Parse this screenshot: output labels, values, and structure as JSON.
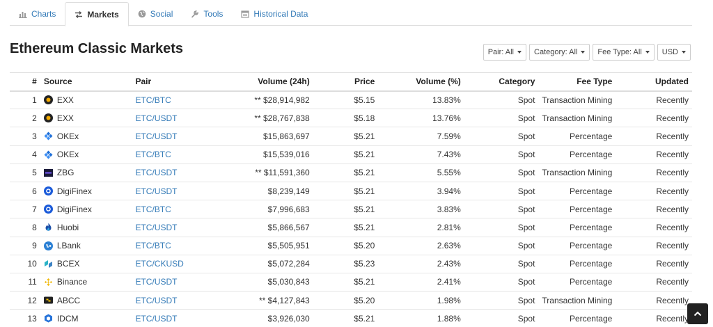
{
  "tabs": [
    {
      "label": "Charts",
      "icon": "bar-chart-icon",
      "active": false
    },
    {
      "label": "Markets",
      "icon": "exchange-arrows-icon",
      "active": true
    },
    {
      "label": "Social",
      "icon": "globe-icon",
      "active": false
    },
    {
      "label": "Tools",
      "icon": "wrench-icon",
      "active": false
    },
    {
      "label": "Historical Data",
      "icon": "calendar-icon",
      "active": false
    }
  ],
  "page_title": "Ethereum Classic Markets",
  "filters": {
    "pair": "Pair: All",
    "category": "Category: All",
    "fee_type": "Fee Type: All",
    "currency": "USD"
  },
  "table": {
    "headers": {
      "rank": "#",
      "source": "Source",
      "pair": "Pair",
      "volume": "Volume (24h)",
      "price": "Price",
      "volume_pct": "Volume (%)",
      "category": "Category",
      "fee_type": "Fee Type",
      "updated": "Updated"
    },
    "rows": [
      {
        "rank": "1",
        "source": "EXX",
        "logo": "exx",
        "pair": "ETC/BTC",
        "volume": "** $28,914,982",
        "price": "$5.15",
        "volume_pct": "13.83%",
        "category": "Spot",
        "fee_type": "Transaction Mining",
        "updated": "Recently"
      },
      {
        "rank": "2",
        "source": "EXX",
        "logo": "exx",
        "pair": "ETC/USDT",
        "volume": "** $28,767,838",
        "price": "$5.18",
        "volume_pct": "13.76%",
        "category": "Spot",
        "fee_type": "Transaction Mining",
        "updated": "Recently"
      },
      {
        "rank": "3",
        "source": "OKEx",
        "logo": "okex",
        "pair": "ETC/USDT",
        "volume": "$15,863,697",
        "price": "$5.21",
        "volume_pct": "7.59%",
        "category": "Spot",
        "fee_type": "Percentage",
        "updated": "Recently"
      },
      {
        "rank": "4",
        "source": "OKEx",
        "logo": "okex",
        "pair": "ETC/BTC",
        "volume": "$15,539,016",
        "price": "$5.21",
        "volume_pct": "7.43%",
        "category": "Spot",
        "fee_type": "Percentage",
        "updated": "Recently"
      },
      {
        "rank": "5",
        "source": "ZBG",
        "logo": "zbg",
        "pair": "ETC/USDT",
        "volume": "** $11,591,360",
        "price": "$5.21",
        "volume_pct": "5.55%",
        "category": "Spot",
        "fee_type": "Transaction Mining",
        "updated": "Recently"
      },
      {
        "rank": "6",
        "source": "DigiFinex",
        "logo": "digifinex",
        "pair": "ETC/USDT",
        "volume": "$8,239,149",
        "price": "$5.21",
        "volume_pct": "3.94%",
        "category": "Spot",
        "fee_type": "Percentage",
        "updated": "Recently"
      },
      {
        "rank": "7",
        "source": "DigiFinex",
        "logo": "digifinex",
        "pair": "ETC/BTC",
        "volume": "$7,996,683",
        "price": "$5.21",
        "volume_pct": "3.83%",
        "category": "Spot",
        "fee_type": "Percentage",
        "updated": "Recently"
      },
      {
        "rank": "8",
        "source": "Huobi",
        "logo": "huobi",
        "pair": "ETC/USDT",
        "volume": "$5,866,567",
        "price": "$5.21",
        "volume_pct": "2.81%",
        "category": "Spot",
        "fee_type": "Percentage",
        "updated": "Recently"
      },
      {
        "rank": "9",
        "source": "LBank",
        "logo": "lbank",
        "pair": "ETC/BTC",
        "volume": "$5,505,951",
        "price": "$5.20",
        "volume_pct": "2.63%",
        "category": "Spot",
        "fee_type": "Percentage",
        "updated": "Recently"
      },
      {
        "rank": "10",
        "source": "BCEX",
        "logo": "bcex",
        "pair": "ETC/CKUSD",
        "volume": "$5,072,284",
        "price": "$5.23",
        "volume_pct": "2.43%",
        "category": "Spot",
        "fee_type": "Percentage",
        "updated": "Recently"
      },
      {
        "rank": "11",
        "source": "Binance",
        "logo": "binance",
        "pair": "ETC/USDT",
        "volume": "$5,030,843",
        "price": "$5.21",
        "volume_pct": "2.41%",
        "category": "Spot",
        "fee_type": "Percentage",
        "updated": "Recently"
      },
      {
        "rank": "12",
        "source": "ABCC",
        "logo": "abcc",
        "pair": "ETC/USDT",
        "volume": "** $4,127,843",
        "price": "$5.20",
        "volume_pct": "1.98%",
        "category": "Spot",
        "fee_type": "Transaction Mining",
        "updated": "Recently"
      },
      {
        "rank": "13",
        "source": "IDCM",
        "logo": "idcm",
        "pair": "ETC/USDT",
        "volume": "$3,926,030",
        "price": "$5.21",
        "volume_pct": "1.88%",
        "category": "Spot",
        "fee_type": "Percentage",
        "updated": "Recently"
      }
    ]
  },
  "colors": {
    "link": "#337ab7",
    "back_to_top": "#222222"
  },
  "back_to_top_icon": "chevron-up-icon"
}
